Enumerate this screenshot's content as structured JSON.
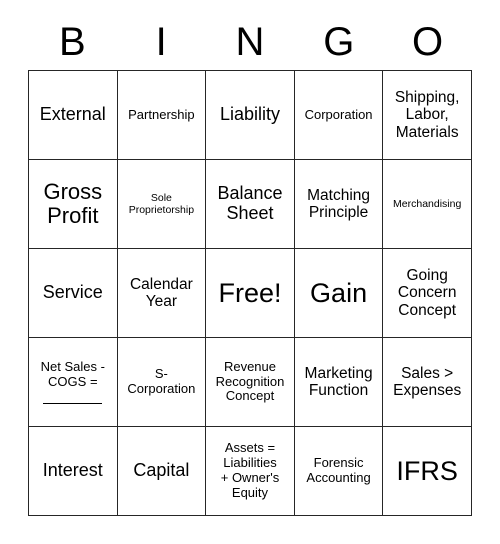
{
  "card": {
    "header": {
      "letters": [
        "B",
        "I",
        "N",
        "G",
        "O"
      ]
    },
    "rows": [
      {
        "cells": [
          {
            "text": "External",
            "size": "lg",
            "free": false,
            "blank_line": false
          },
          {
            "text": "Partnership",
            "size": "sm",
            "free": false,
            "blank_line": false
          },
          {
            "text": "Liability",
            "size": "lg",
            "free": false,
            "blank_line": false
          },
          {
            "text": "Corporation",
            "size": "sm",
            "free": false,
            "blank_line": false
          },
          {
            "text": "Shipping,\nLabor,\nMaterials",
            "size": "md",
            "free": false,
            "blank_line": false
          }
        ]
      },
      {
        "cells": [
          {
            "text": "Gross\nProfit",
            "size": "xl",
            "free": false,
            "blank_line": false
          },
          {
            "text": "Sole\nProprietorship",
            "size": "xs",
            "free": false,
            "blank_line": false
          },
          {
            "text": "Balance\nSheet",
            "size": "lg",
            "free": false,
            "blank_line": false
          },
          {
            "text": "Matching\nPrinciple",
            "size": "md",
            "free": false,
            "blank_line": false
          },
          {
            "text": "Merchandising",
            "size": "xs",
            "free": false,
            "blank_line": false
          }
        ]
      },
      {
        "cells": [
          {
            "text": "Service",
            "size": "lg",
            "free": false,
            "blank_line": false
          },
          {
            "text": "Calendar\nYear",
            "size": "md",
            "free": false,
            "blank_line": false
          },
          {
            "text": "Free!",
            "size": "xxl",
            "free": true,
            "blank_line": false
          },
          {
            "text": "Gain",
            "size": "xxl",
            "free": false,
            "blank_line": false
          },
          {
            "text": "Going\nConcern\nConcept",
            "size": "md",
            "free": false,
            "blank_line": false
          }
        ]
      },
      {
        "cells": [
          {
            "text": "Net Sales -\nCOGS =",
            "size": "sm",
            "free": false,
            "blank_line": true
          },
          {
            "text": "S-\nCorporation",
            "size": "sm",
            "free": false,
            "blank_line": false
          },
          {
            "text": "Revenue\nRecognition\nConcept",
            "size": "sm",
            "free": false,
            "blank_line": false
          },
          {
            "text": "Marketing\nFunction",
            "size": "md",
            "free": false,
            "blank_line": false
          },
          {
            "text": "Sales >\nExpenses",
            "size": "md",
            "free": false,
            "blank_line": false
          }
        ]
      },
      {
        "cells": [
          {
            "text": "Interest",
            "size": "lg",
            "free": false,
            "blank_line": false
          },
          {
            "text": "Capital",
            "size": "lg",
            "free": false,
            "blank_line": false
          },
          {
            "text": "Assets =\nLiabilities\n+ Owner's\nEquity",
            "size": "sm",
            "free": false,
            "blank_line": false
          },
          {
            "text": "Forensic\nAccounting",
            "size": "sm",
            "free": false,
            "blank_line": false
          },
          {
            "text": "IFRS",
            "size": "xxl",
            "free": false,
            "blank_line": false
          }
        ]
      }
    ]
  }
}
